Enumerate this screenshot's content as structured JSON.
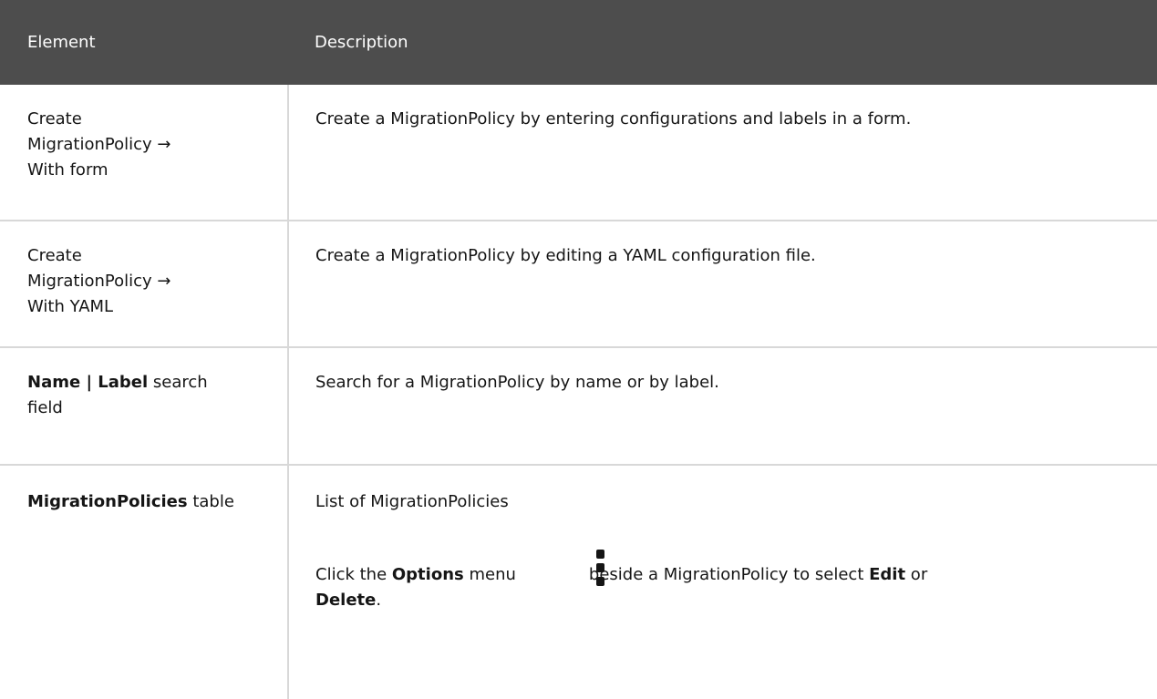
{
  "header": {
    "col1": "Element",
    "col2": "Description"
  },
  "rows": [
    {
      "element": {
        "line1": "Create",
        "line2": "MigrationPolicy →",
        "line3": "With form"
      },
      "description": "Create a MigrationPolicy by entering configurations and labels in a form."
    },
    {
      "element": {
        "line1": "Create",
        "line2": "MigrationPolicy →",
        "line3": "With YAML"
      },
      "description": "Create a MigrationPolicy by editing a YAML configuration file."
    },
    {
      "element": {
        "bold": "Name | Label",
        "rest1": " search",
        "line2": "field"
      },
      "description": "Search for a MigrationPolicy by name or by label."
    },
    {
      "element": {
        "bold": "MigrationPolicies",
        "rest": " table"
      },
      "description": {
        "para1": "List of MigrationPolicies",
        "para2_a": "Click the ",
        "para2_options": "Options",
        "para2_b": " menu",
        "para2_c": "beside a MigrationPolicy to select ",
        "para2_edit": "Edit",
        "para2_or": " or",
        "para2_delete": "Delete",
        "para2_end": "."
      },
      "icon": "kebab-menu-icon"
    }
  ]
}
